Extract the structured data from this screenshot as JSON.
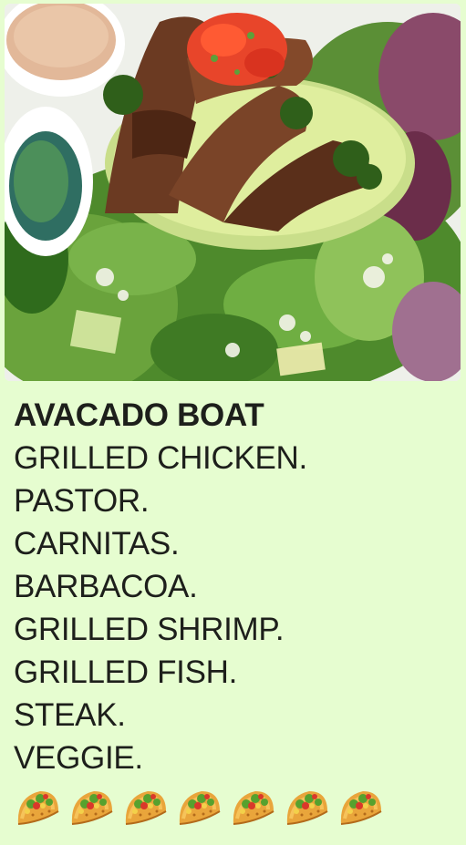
{
  "photo": {
    "alt": "Avocado boat with grilled steak, pico de gallo, chimichurri and mixed greens"
  },
  "menu": {
    "title": "AVACADO BOAT",
    "items": [
      {
        "label": "GRILLED CHICKEN."
      },
      {
        "label": "PASTOR."
      },
      {
        "label": "CARNITAS."
      },
      {
        "label": "BARBACOA."
      },
      {
        "label": "GRILLED SHRIMP."
      },
      {
        "label": "GRILLED FISH."
      },
      {
        "label": "STEAK."
      },
      {
        "label": "VEGGIE."
      }
    ]
  },
  "decorations": {
    "taco_icon": "taco-emoji",
    "taco_count": 7
  },
  "colors": {
    "background": "#e6fdd0",
    "text": "#1d1f1b"
  }
}
